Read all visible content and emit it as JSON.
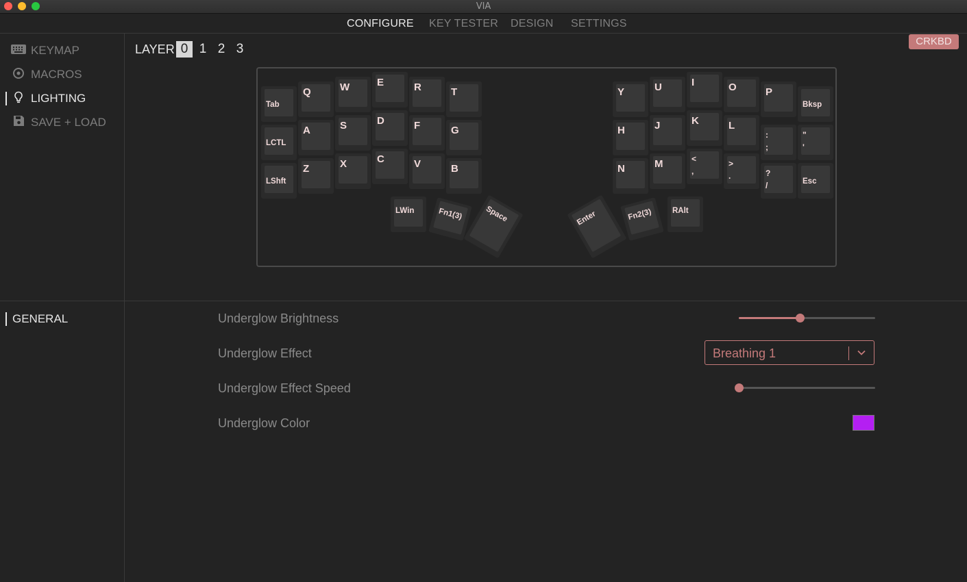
{
  "window": {
    "title": "VIA"
  },
  "menu": {
    "items": [
      "CONFIGURE",
      "KEY TESTER",
      "DESIGN",
      "SETTINGS"
    ],
    "active": "CONFIGURE"
  },
  "sidebar": {
    "items": [
      {
        "label": "KEYMAP",
        "icon": "keyboard-icon"
      },
      {
        "label": "MACROS",
        "icon": "circle-dot-icon"
      },
      {
        "label": "LIGHTING",
        "icon": "lightbulb-icon"
      },
      {
        "label": "SAVE + LOAD",
        "icon": "floppy-disk-icon"
      }
    ],
    "active": "LIGHTING",
    "section": "GENERAL"
  },
  "layers": {
    "label": "LAYER",
    "options": [
      "0",
      "1",
      "2",
      "3"
    ],
    "active": "0"
  },
  "device": {
    "name": "CRKBD"
  },
  "keys": {
    "left": {
      "row1": [
        "Tab",
        "Q",
        "W",
        "E",
        "R",
        "T"
      ],
      "row2": [
        "LCTL",
        "A",
        "S",
        "D",
        "F",
        "G"
      ],
      "row3": [
        "LShft",
        "Z",
        "X",
        "C",
        "V",
        "B"
      ],
      "thumbs": [
        "LWin",
        "Fn1(3)",
        "Space"
      ]
    },
    "right": {
      "row1": [
        "Y",
        "U",
        "I",
        "O",
        "P",
        "Bksp"
      ],
      "row2": [
        "H",
        "J",
        "K",
        "L",
        ":\n;",
        "\"\n'"
      ],
      "row3": [
        "N",
        "M",
        "<\n,",
        ">\n.",
        "?\n/",
        "Esc"
      ],
      "thumbs": [
        "Enter",
        "Fn2(3)",
        "RAlt"
      ]
    }
  },
  "lighting": {
    "brightness": {
      "label": "Underglow Brightness",
      "value_fraction": 0.45
    },
    "effect": {
      "label": "Underglow Effect",
      "value": "Breathing 1"
    },
    "speed": {
      "label": "Underglow Effect Speed",
      "value_fraction": 0.0
    },
    "color": {
      "label": "Underglow Color",
      "value": "#b41ff2"
    }
  },
  "colors": {
    "accent": "#c47a7a",
    "background": "#232323"
  }
}
